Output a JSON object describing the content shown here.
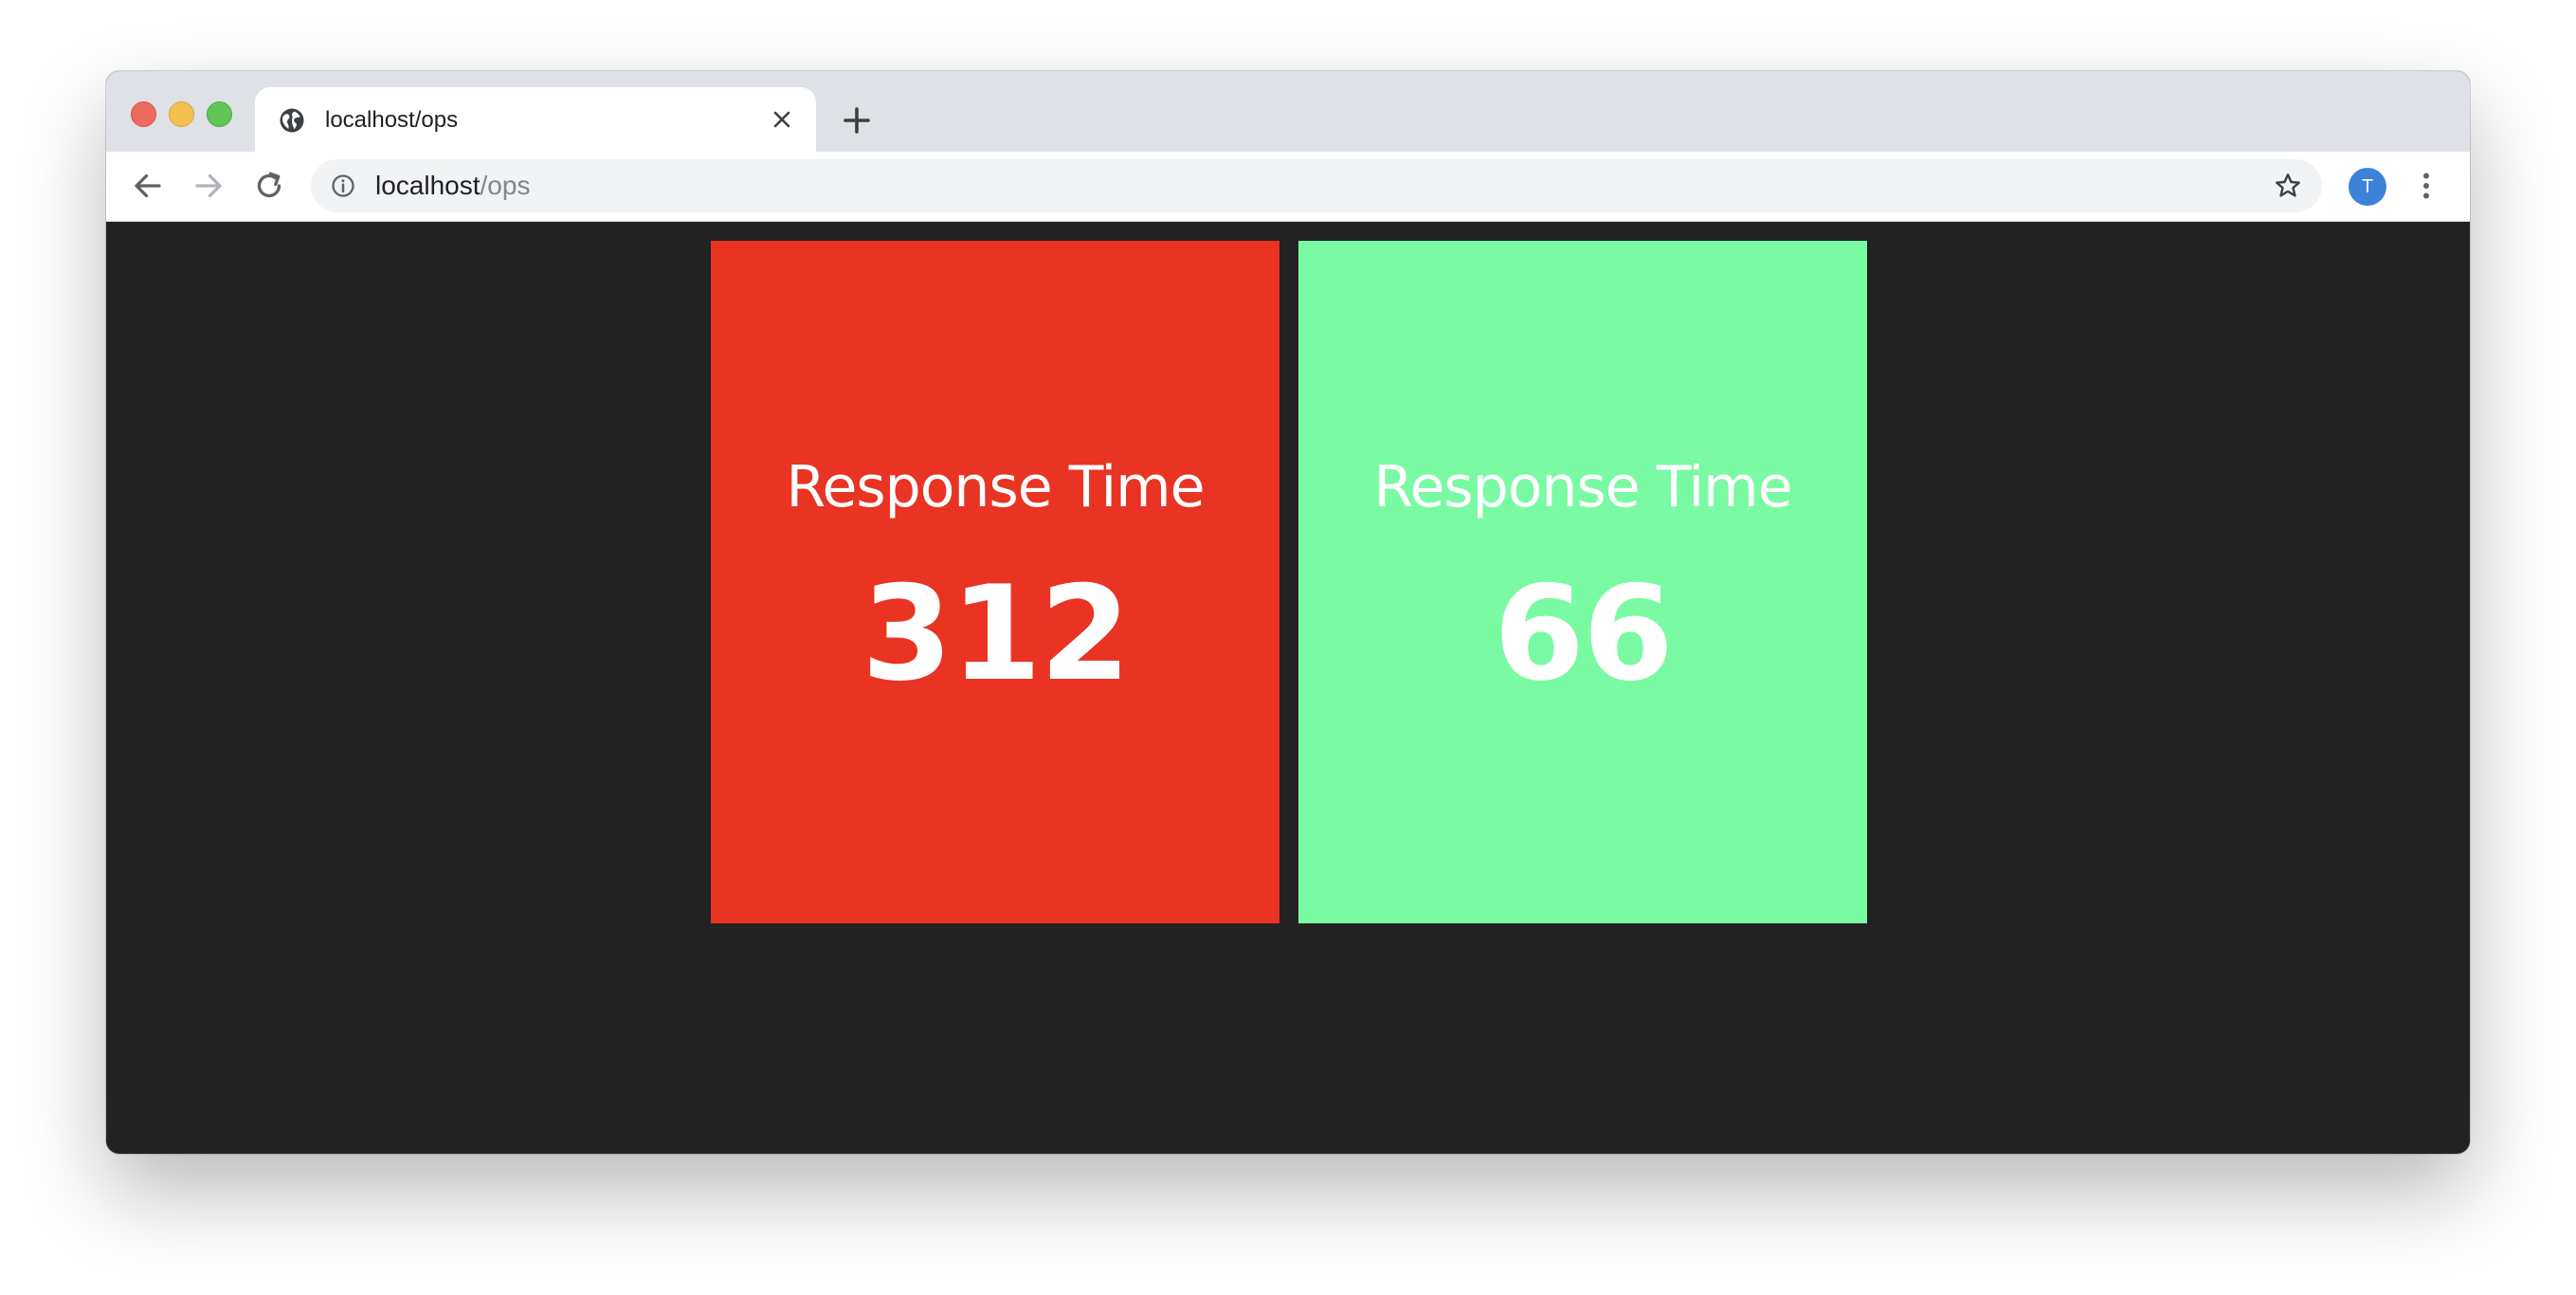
{
  "browser": {
    "tab": {
      "title": "localhost/ops",
      "favicon": "globe-icon",
      "close_icon": "close-icon"
    },
    "new_tab_icon": "plus-icon",
    "toolbar": {
      "back_icon": "arrow-left-icon",
      "forward_icon": "arrow-right-icon",
      "reload_icon": "reload-icon",
      "url_host": "localhost",
      "url_path": "/ops",
      "info_icon": "info-icon",
      "bookmark_icon": "star-icon",
      "avatar_initial": "T",
      "menu_icon": "more-vertical-icon"
    }
  },
  "tiles": [
    {
      "label": "Response Time",
      "value": "312",
      "color": "#e93323"
    },
    {
      "label": "Response Time",
      "value": "66",
      "color": "#7afaa3"
    }
  ],
  "page_background": "#222222",
  "avatar_color": "#3b82d9"
}
